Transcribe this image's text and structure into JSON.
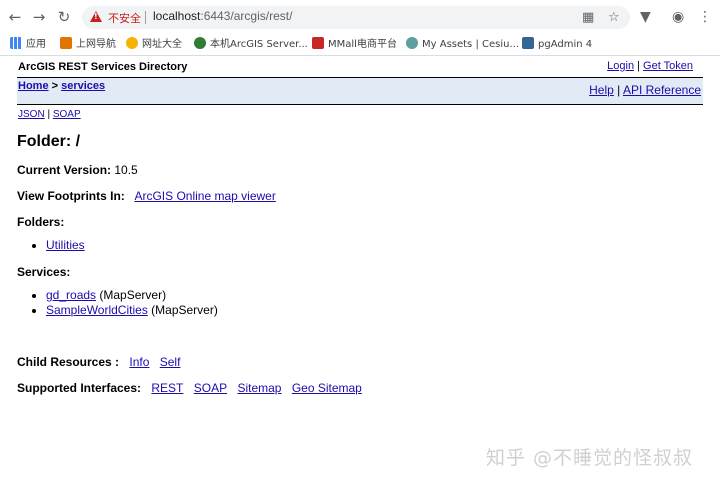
{
  "browser": {
    "security_label": "不安全",
    "url_host": "localhost",
    "url_rest": ":6443/arcgis/rest/",
    "bookmarks": [
      {
        "label": "应用",
        "color": "#4285f4"
      },
      {
        "label": "上网导航",
        "color": "#e37400"
      },
      {
        "label": "网址大全",
        "color": "#f4b400"
      },
      {
        "label": "本机ArcGIS Server...",
        "color": "#2e7d32"
      },
      {
        "label": "MMall电商平台",
        "color": "#c62828"
      },
      {
        "label": "My Assets | Cesiu...",
        "color": "#5f9ea0"
      },
      {
        "label": "pgAdmin 4",
        "color": "#336791"
      }
    ]
  },
  "page": {
    "directory_title": "ArcGIS REST Services Directory",
    "login": "Login",
    "get_token": "Get Token",
    "breadcrumb_home": "Home",
    "breadcrumb_sep": " > ",
    "breadcrumb_current": "services",
    "help": "Help",
    "api_reference": "API Reference",
    "json": "JSON",
    "soap": "SOAP",
    "folder_heading": "Folder: /",
    "current_version_label": "Current Version:",
    "current_version_value": "10.5",
    "footprints_label": "View Footprints In:",
    "footprints_link": "ArcGIS Online map viewer",
    "folders_label": "Folders:",
    "folders": [
      "Utilities"
    ],
    "services_label": "Services:",
    "services": [
      {
        "name": "gd_roads",
        "type": "(MapServer)"
      },
      {
        "name": "SampleWorldCities",
        "type": "(MapServer)"
      }
    ],
    "child_resources_label": "Child Resources :",
    "child_resources": [
      "Info",
      "Self"
    ],
    "supported_interfaces_label": "Supported Interfaces:",
    "supported_interfaces": [
      "REST",
      "SOAP",
      "Sitemap",
      "Geo Sitemap"
    ]
  },
  "watermark": "知乎 @不睡觉的怪叔叔"
}
